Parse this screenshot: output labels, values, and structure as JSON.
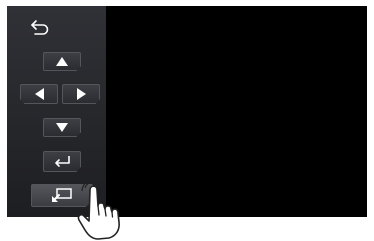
{
  "screen": {
    "background": "#000000"
  },
  "side_panel": {
    "buttons": [
      {
        "name": "back",
        "icon": "back-arrow-icon"
      },
      {
        "name": "up",
        "icon": "triangle-up-icon"
      },
      {
        "name": "left",
        "icon": "triangle-left-icon"
      },
      {
        "name": "right",
        "icon": "triangle-right-icon"
      },
      {
        "name": "down",
        "icon": "triangle-down-icon"
      },
      {
        "name": "enter",
        "icon": "enter-return-icon"
      },
      {
        "name": "input-select",
        "icon": "input-switch-icon",
        "pressed": true
      }
    ],
    "colors": {
      "panel": "#26272b",
      "button": "#35363b",
      "icon": "#ffffff"
    }
  },
  "overlay": {
    "icon": "pointing-hand-icon"
  }
}
